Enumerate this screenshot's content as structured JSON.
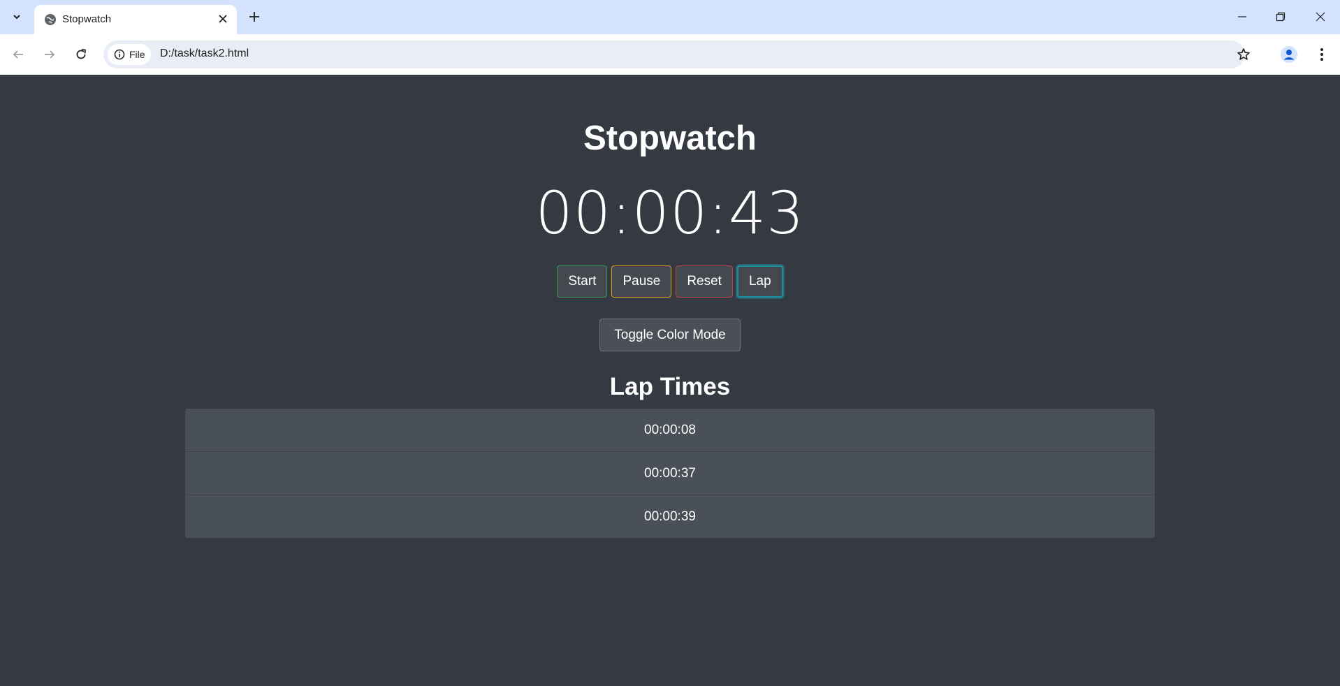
{
  "browser": {
    "tab_title": "Stopwatch",
    "site_info_label": "File",
    "url": "D:/task/task2.html"
  },
  "page": {
    "title": "Stopwatch",
    "timer": "00:00:43",
    "buttons": {
      "start": "Start",
      "pause": "Pause",
      "reset": "Reset",
      "lap": "Lap"
    },
    "toggle_label": "Toggle Color Mode",
    "lap_heading": "Lap Times",
    "laps": [
      "00:00:08",
      "00:00:37",
      "00:00:39"
    ]
  },
  "colors": {
    "page_background": "#353941",
    "start_border": "#2e9a5a",
    "pause_border": "#d3a217",
    "reset_border": "#c0404d",
    "lap_border": "#1e8da0",
    "tabbar_background": "#d3e3fd"
  },
  "icons": {
    "tab_search": "chevron-down-icon",
    "favicon": "globe-icon",
    "tab_close": "close-icon",
    "new_tab": "plus-icon",
    "back": "arrow-left-icon",
    "forward": "arrow-right-icon",
    "reload": "reload-icon",
    "site_info": "info-icon",
    "bookmark": "star-icon",
    "profile": "profile-icon",
    "menu": "kebab-menu-icon"
  }
}
